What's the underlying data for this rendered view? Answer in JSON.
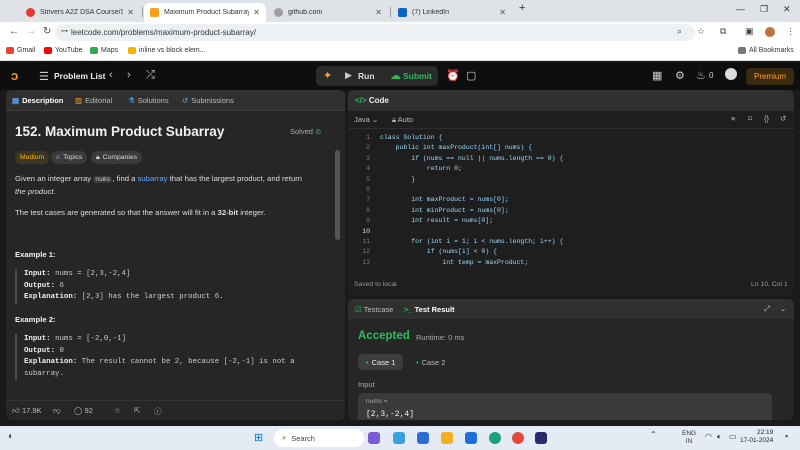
{
  "browser": {
    "tabs": [
      {
        "title": "Strivers A2Z DSA Course/Sheet",
        "active": false,
        "favicon_color": "#e53935"
      },
      {
        "title": "Maximum Product Subarray - L",
        "active": true,
        "favicon_color": "#f89f1b"
      },
      {
        "title": "github.com",
        "active": false,
        "favicon_color": "#9e9e9e"
      },
      {
        "title": "(7) LinkedIn",
        "active": false,
        "favicon_color": "#0a66c2"
      }
    ],
    "new_tab": "+",
    "url": "leetcode.com/problems/maximum-product-subarray/",
    "bookmarks": [
      {
        "label": "Gmail",
        "color": "#ea4335"
      },
      {
        "label": "YouTube",
        "color": "#ff0000"
      },
      {
        "label": "Maps",
        "color": "#34a853"
      },
      {
        "label": "inline vs block elem...",
        "color": "#f4b400"
      }
    ],
    "all_bookmarks": "All Bookmarks"
  },
  "nav": {
    "problem_list": "Problem List",
    "run": "Run",
    "submit": "Submit",
    "streak": "0",
    "premium": "Premium"
  },
  "left": {
    "tabs": [
      "Description",
      "Editorial",
      "Solutions",
      "Submissions"
    ],
    "title": "152. Maximum Product Subarray",
    "solved": "Solved",
    "difficulty": "Medium",
    "topics": "Topics",
    "companies": "Companies",
    "desc1_a": "Given an integer array ",
    "desc1_code": "nums",
    "desc1_b": ", find a ",
    "desc1_link": "subarray",
    "desc1_c": " that has the largest product, and return",
    "desc1_d": "the product",
    "desc1_e": ".",
    "desc2_a": "The test cases are generated so that the answer will fit in a ",
    "desc2_b": "32-bit",
    "desc2_c": " integer.",
    "example1": {
      "heading": "Example 1:",
      "input_label": "Input:",
      "input": "nums = [2,3,-2,4]",
      "output_label": "Output:",
      "output": "6",
      "explanation_label": "Explanation:",
      "explanation": "[2,3] has the largest product 6."
    },
    "example2": {
      "heading": "Example 2:",
      "input_label": "Input:",
      "input": "nums = [-2,0,-1]",
      "output_label": "Output:",
      "output": "0",
      "explanation_label": "Explanation:",
      "explanation": "The result cannot be 2, because [-2,-1] is not a",
      "explanation_cont": "subarray."
    },
    "likes": "17.9K",
    "comments": "92"
  },
  "code": {
    "title": "Code",
    "language": "Java",
    "mode": "Auto",
    "lines": [
      {
        "n": "1",
        "text": "class Solution {"
      },
      {
        "n": "2",
        "text": "    public int maxProduct(int[] nums) {"
      },
      {
        "n": "3",
        "text": "        if (nums == null || nums.length == 0) {"
      },
      {
        "n": "4",
        "text": "            return 0;"
      },
      {
        "n": "5",
        "text": "        }"
      },
      {
        "n": "6",
        "text": ""
      },
      {
        "n": "7",
        "text": "        int maxProduct = nums[0];"
      },
      {
        "n": "8",
        "text": "        int minProduct = nums[0];"
      },
      {
        "n": "9",
        "text": "        int result = nums[0];"
      },
      {
        "n": "10",
        "text": ""
      },
      {
        "n": "11",
        "text": "        for (int i = 1; i < nums.length; i++) {"
      },
      {
        "n": "12",
        "text": "            if (nums[i] < 0) {"
      },
      {
        "n": "13",
        "text": "                int temp = maxProduct;"
      }
    ],
    "saved": "Saved to local",
    "cursor": "Ln 10, Col 1"
  },
  "result": {
    "tab_testcase": "Testcase",
    "tab_result": "Test Result",
    "status": "Accepted",
    "runtime": "Runtime: 0 ms",
    "case1": "Case 1",
    "case2": "Case 2",
    "input_label": "Input",
    "input_var": "nums =",
    "input_value": "[2,3,-2,4]"
  },
  "taskbar": {
    "search": "Search",
    "lang": "ENG",
    "region": "IN",
    "time": "22:19",
    "date": "17-01-2024"
  }
}
